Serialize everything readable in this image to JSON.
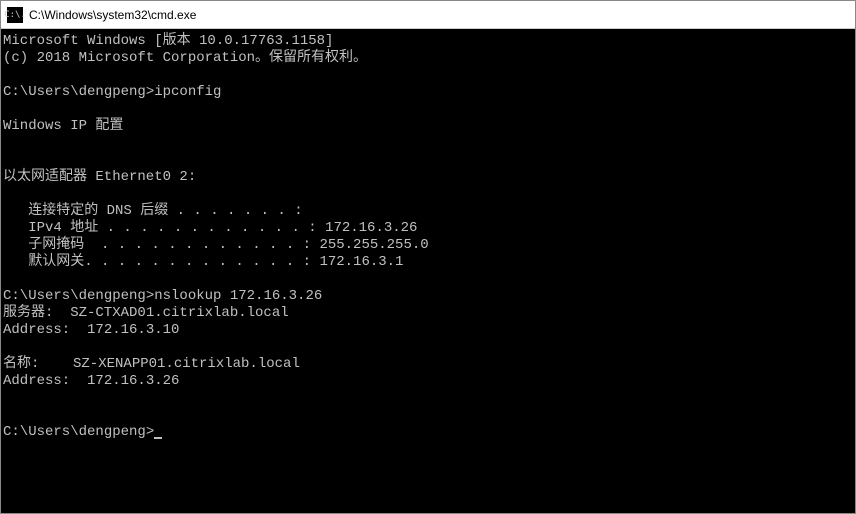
{
  "window": {
    "title": "C:\\Windows\\system32\\cmd.exe",
    "icon_label": "C:\\."
  },
  "terminal": {
    "lines": [
      "Microsoft Windows [版本 10.0.17763.1158]",
      "(c) 2018 Microsoft Corporation。保留所有权利。",
      "",
      "C:\\Users\\dengpeng>ipconfig",
      "",
      "Windows IP 配置",
      "",
      "",
      "以太网适配器 Ethernet0 2:",
      "",
      "   连接特定的 DNS 后缀 . . . . . . . :",
      "   IPv4 地址 . . . . . . . . . . . . : 172.16.3.26",
      "   子网掩码  . . . . . . . . . . . . : 255.255.255.0",
      "   默认网关. . . . . . . . . . . . . : 172.16.3.1",
      "",
      "C:\\Users\\dengpeng>nslookup 172.16.3.26",
      "服务器:  SZ-CTXAD01.citrixlab.local",
      "Address:  172.16.3.10",
      "",
      "名称:    SZ-XENAPP01.citrixlab.local",
      "Address:  172.16.3.26",
      "",
      ""
    ],
    "prompt": "C:\\Users\\dengpeng>"
  }
}
